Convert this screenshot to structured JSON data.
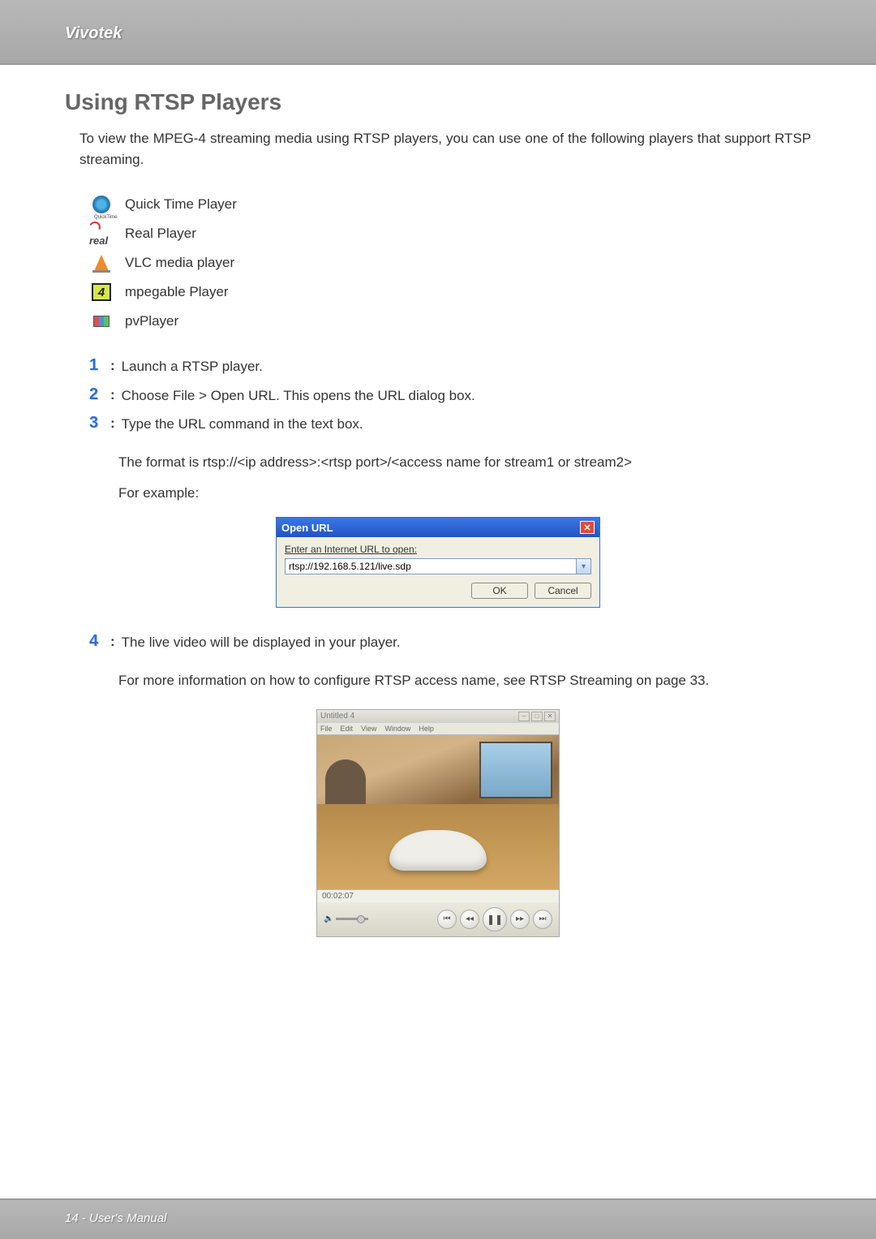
{
  "header": {
    "brand": "Vivotek"
  },
  "section_title": "Using RTSP Players",
  "intro": "To view the MPEG-4 streaming media using RTSP players, you can use one of the following players that support RTSP streaming.",
  "players": [
    {
      "label": "Quick Time Player"
    },
    {
      "label": "Real Player"
    },
    {
      "label": "VLC media player"
    },
    {
      "label": "mpegable Player"
    },
    {
      "label": "pvPlayer"
    }
  ],
  "steps": {
    "s1": "Launch a RTSP player.",
    "s2": "Choose File > Open URL. This opens the URL dialog box.",
    "s3": "Type the URL command in the text box.",
    "s3_sub1": "The format is rtsp://<ip address>:<rtsp port>/<access name for stream1 or stream2>",
    "s3_sub2": "For example:",
    "s4": "The live video will be displayed in your player.",
    "s4_sub": "For more information on how to configure RTSP access name, see RTSP Streaming on page 33."
  },
  "open_url": {
    "title": "Open URL",
    "label": "Enter an Internet URL to open:",
    "value": "rtsp://192.168.5.121/live.sdp",
    "ok": "OK",
    "cancel": "Cancel"
  },
  "video_player": {
    "title": "Untitled 4",
    "menu": {
      "file": "File",
      "edit": "Edit",
      "view": "View",
      "window": "Window",
      "help": "Help"
    },
    "time": "00:02:07"
  },
  "footer": {
    "text": "14 - User's Manual"
  }
}
